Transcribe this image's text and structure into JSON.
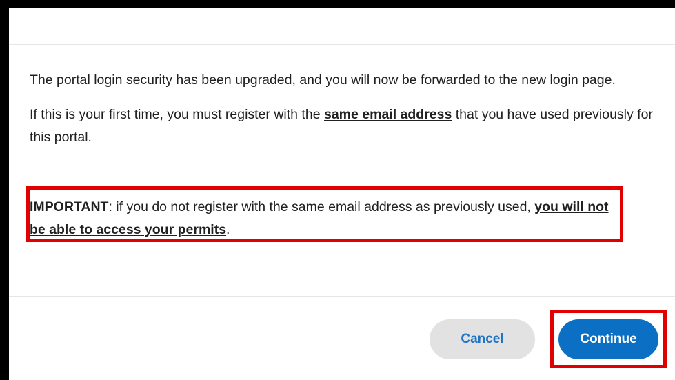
{
  "dialog": {
    "body": {
      "paragraph1": "The portal login security has been upgraded, and you will now be forwarded to the new login page.",
      "paragraph2_before": "If this is your first time, you must register with the ",
      "paragraph2_emphasis": "same email address",
      "paragraph2_after": " that you have used previously for this portal.",
      "important_label": "IMPORTANT",
      "important_text": ": if you do not register with the same email address as previously used, ",
      "important_emphasis": "you will not be able to access your permits",
      "important_end": "."
    },
    "footer": {
      "cancel_label": "Cancel",
      "continue_label": "Continue"
    }
  },
  "colors": {
    "highlight": "#e00000",
    "primary": "#0b6fc4",
    "secondary_bg": "#e2e2e2",
    "secondary_text": "#1e74c6",
    "backdrop": "#000000"
  }
}
